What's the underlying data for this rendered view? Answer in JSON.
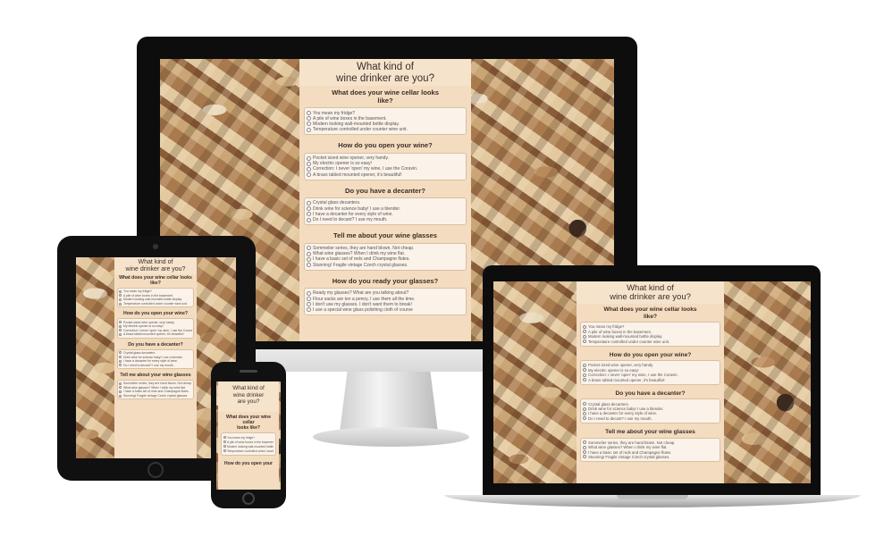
{
  "quiz": {
    "title_line1": "What kind of",
    "title_line2": "wine drinker are you?",
    "questions": [
      {
        "title": "What does your wine cellar looks like?",
        "options": [
          "You mean my fridge?",
          "A pile of wine boxes in the basement.",
          "Modern looking wall-mounted bottle display.",
          "Temperature controlled under counter wine unit."
        ]
      },
      {
        "title": "How do you open your wine?",
        "options": [
          "Pocket sized wine opener, very handy.",
          "My electric opener is so easy!",
          "Correction: I never 'open' my wine, I use the Coravin.",
          "A brass tabled mounted opener, it's beautiful!"
        ]
      },
      {
        "title": "Do you have a decanter?",
        "options": [
          "Crystal glass decanters.",
          "Drink wine for science baby! I use a blender.",
          "I have a decanter for every style of wine.",
          "Do I need to decant? I use my mouth."
        ]
      },
      {
        "title": "Tell me about your wine glasses",
        "options": [
          "Sommelier series, they are hand blown. Not cheap.",
          "What wine glasses? When I drink my wine flat.",
          "I have a basic set of reds and Champagne flutes.",
          "Stunning! Fragile vintage Czech crystal glasses."
        ]
      },
      {
        "title": "How do you ready your glasses?",
        "options": [
          "Ready my glasses? What are you talking about?",
          "Flour sacks are ten a penny, I use them all the time.",
          "I don't use my glasses. I don't want them to break!",
          "I use a special wine glass polishing cloth of course"
        ]
      }
    ]
  },
  "phone": {
    "title_line1": "What kind of",
    "title_line2": "wine drinker",
    "title_line3": "are you?",
    "q1_line1": "What does your wine",
    "q1_line2": "cellar",
    "q1_line3": "looks like?",
    "q2_partial": "How do you open your"
  },
  "colors": {
    "panel": "#f3dcc0",
    "option_box": "#fbf3ea",
    "text": "#3a2e28",
    "device_frame": "#0d0d0d"
  }
}
